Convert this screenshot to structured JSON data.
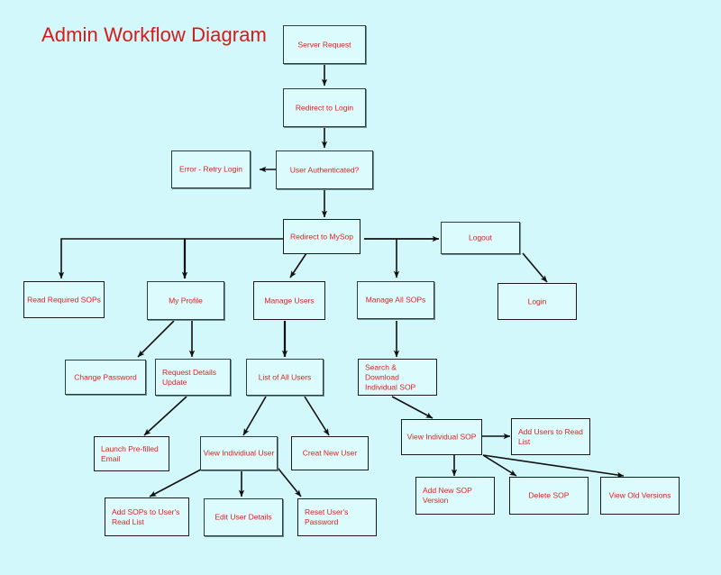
{
  "page": {
    "title": "Admin Workflow Diagram",
    "background_color": "#d3f8fb",
    "title_color": "#d61a1a",
    "node_fill": "#dcfbfd",
    "node_border": "#1b1b1b",
    "node_text_color": "#e02020",
    "connector_color": "#101010"
  },
  "nodes": {
    "server_request": "Server Request",
    "redirect_to_login": "Redirect to Login",
    "error_retry_login": "Error - Retry Login",
    "user_authenticated": "User Authenticated?",
    "redirect_to_mysop": "Redirect to MySop",
    "logout": "Logout",
    "login": "Login",
    "read_required_sops": "Read Required SOPs",
    "my_profile": "My Profile",
    "manage_users": "Manage Users",
    "manage_all_sops": "Manage All SOPs",
    "change_password": "Change Password",
    "request_details_update": "Request Details Update",
    "list_of_all_users": "List of All Users",
    "search_download_individual_sop": "Search & Download Individual SOP",
    "launch_prefilled_email": "Launch Pre-filled Email",
    "view_individual_user": "View Individiual User",
    "creat_new_user": "Creat New User",
    "view_individual_sop": "View Individual SOP",
    "add_users_to_read_list": "Add Users to Read List",
    "add_sops_to_users_read_list": "Add SOPs to User's Read List",
    "edit_user_details": "Edit User Details",
    "reset_users_password": "Reset User's Password",
    "add_new_sop_version": "Add New SOP Version",
    "delete_sop": "Delete SOP",
    "view_old_versions": "View Old Versions"
  },
  "flow_edges": [
    {
      "from": "server_request",
      "to": "redirect_to_login"
    },
    {
      "from": "redirect_to_login",
      "to": "user_authenticated"
    },
    {
      "from": "user_authenticated",
      "to": "error_retry_login"
    },
    {
      "from": "user_authenticated",
      "to": "redirect_to_mysop"
    },
    {
      "from": "redirect_to_mysop",
      "to": "read_required_sops"
    },
    {
      "from": "redirect_to_mysop",
      "to": "my_profile"
    },
    {
      "from": "redirect_to_mysop",
      "to": "manage_users"
    },
    {
      "from": "redirect_to_mysop",
      "to": "manage_all_sops"
    },
    {
      "from": "redirect_to_mysop",
      "to": "logout"
    },
    {
      "from": "logout",
      "to": "login"
    },
    {
      "from": "my_profile",
      "to": "change_password"
    },
    {
      "from": "my_profile",
      "to": "request_details_update"
    },
    {
      "from": "manage_users",
      "to": "list_of_all_users"
    },
    {
      "from": "manage_all_sops",
      "to": "search_download_individual_sop"
    },
    {
      "from": "request_details_update",
      "to": "launch_prefilled_email"
    },
    {
      "from": "list_of_all_users",
      "to": "view_individual_user"
    },
    {
      "from": "list_of_all_users",
      "to": "creat_new_user"
    },
    {
      "from": "search_download_individual_sop",
      "to": "view_individual_sop"
    },
    {
      "from": "view_individual_user",
      "to": "add_sops_to_users_read_list"
    },
    {
      "from": "view_individual_user",
      "to": "edit_user_details"
    },
    {
      "from": "view_individual_user",
      "to": "reset_users_password"
    },
    {
      "from": "view_individual_sop",
      "to": "add_users_to_read_list"
    },
    {
      "from": "view_individual_sop",
      "to": "add_new_sop_version"
    },
    {
      "from": "view_individual_sop",
      "to": "delete_sop"
    },
    {
      "from": "view_individual_sop",
      "to": "view_old_versions"
    }
  ]
}
